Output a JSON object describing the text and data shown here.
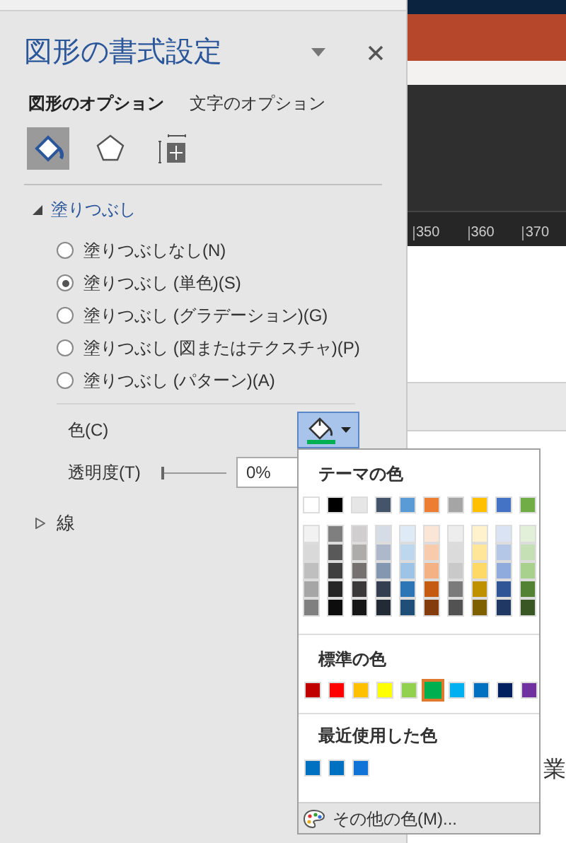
{
  "panel": {
    "title": "図形の書式設定",
    "tabs": [
      {
        "label": "図形のオプション",
        "selected": true
      },
      {
        "label": "文字のオプション",
        "selected": false
      }
    ],
    "icon_tabs": [
      {
        "kind": "fill",
        "selected": true
      },
      {
        "kind": "effects",
        "selected": false
      },
      {
        "kind": "size",
        "selected": false
      }
    ],
    "fill_section": {
      "title": "塗りつぶし",
      "expanded": true,
      "options": [
        {
          "label": "塗りつぶしなし(N)",
          "selected": false
        },
        {
          "label": "塗りつぶし (単色)(S)",
          "selected": true
        },
        {
          "label": "塗りつぶし (グラデーション)(G)",
          "selected": false
        },
        {
          "label": "塗りつぶし (図またはテクスチャ)(P)",
          "selected": false
        },
        {
          "label": "塗りつぶし (パターン)(A)",
          "selected": false
        }
      ],
      "color_label": "色(C)",
      "color": "#00b050",
      "transparency_label": "透明度(T)",
      "transparency": {
        "level": 0,
        "value": "0%"
      }
    },
    "line_section": {
      "title": "線",
      "expanded": false
    }
  },
  "document": {
    "ruler_labels": [
      "350",
      "360",
      "370"
    ],
    "text": "業"
  },
  "color_menu": {
    "theme_title": "テーマの色",
    "theme_colors": [
      {
        "color": "#ffffff",
        "selected": false
      },
      {
        "color": "#000000",
        "selected": false
      },
      {
        "color": "#e7e6e6",
        "selected": false
      },
      {
        "color": "#44546a",
        "selected": false
      },
      {
        "color": "#5b9bd5",
        "selected": false
      },
      {
        "color": "#ed7d31",
        "selected": false
      },
      {
        "color": "#a5a5a5",
        "selected": false
      },
      {
        "color": "#ffc000",
        "selected": false
      },
      {
        "color": "#4472c4",
        "selected": false
      },
      {
        "color": "#70ad47",
        "selected": false
      }
    ],
    "shade_columns": [
      {
        "shades": [
          {
            "color": "#f2f2f2",
            "selected": false
          },
          {
            "color": "#d9d9d9",
            "selected": false
          },
          {
            "color": "#bfbfbf",
            "selected": false
          },
          {
            "color": "#a6a6a6",
            "selected": false
          },
          {
            "color": "#808080",
            "selected": false
          }
        ]
      },
      {
        "shades": [
          {
            "color": "#7f7f7f",
            "selected": false
          },
          {
            "color": "#595959",
            "selected": false
          },
          {
            "color": "#404040",
            "selected": false
          },
          {
            "color": "#262626",
            "selected": false
          },
          {
            "color": "#0d0d0d",
            "selected": false
          }
        ]
      },
      {
        "shades": [
          {
            "color": "#d0cece",
            "selected": false
          },
          {
            "color": "#aeabab",
            "selected": false
          },
          {
            "color": "#757171",
            "selected": false
          },
          {
            "color": "#3a3838",
            "selected": false
          },
          {
            "color": "#171616",
            "selected": false
          }
        ]
      },
      {
        "shades": [
          {
            "color": "#d6dce5",
            "selected": false
          },
          {
            "color": "#adb9ca",
            "selected": false
          },
          {
            "color": "#8497b0",
            "selected": false
          },
          {
            "color": "#333f50",
            "selected": false
          },
          {
            "color": "#222a35",
            "selected": false
          }
        ]
      },
      {
        "shades": [
          {
            "color": "#deebf7",
            "selected": false
          },
          {
            "color": "#bdd7ee",
            "selected": false
          },
          {
            "color": "#9dc3e6",
            "selected": false
          },
          {
            "color": "#2e75b6",
            "selected": false
          },
          {
            "color": "#1f4e79",
            "selected": false
          }
        ]
      },
      {
        "shades": [
          {
            "color": "#fbe5d6",
            "selected": false
          },
          {
            "color": "#f8cbad",
            "selected": false
          },
          {
            "color": "#f4b183",
            "selected": false
          },
          {
            "color": "#c55a11",
            "selected": false
          },
          {
            "color": "#843c0c",
            "selected": false
          }
        ]
      },
      {
        "shades": [
          {
            "color": "#ededed",
            "selected": false
          },
          {
            "color": "#dbdbdb",
            "selected": false
          },
          {
            "color": "#c9c9c9",
            "selected": false
          },
          {
            "color": "#7b7b7b",
            "selected": false
          },
          {
            "color": "#525252",
            "selected": false
          }
        ]
      },
      {
        "shades": [
          {
            "color": "#fff2cc",
            "selected": false
          },
          {
            "color": "#ffe699",
            "selected": false
          },
          {
            "color": "#ffd966",
            "selected": false
          },
          {
            "color": "#bf9000",
            "selected": false
          },
          {
            "color": "#7f6000",
            "selected": false
          }
        ]
      },
      {
        "shades": [
          {
            "color": "#dae3f3",
            "selected": false
          },
          {
            "color": "#b4c7e7",
            "selected": false
          },
          {
            "color": "#8faadc",
            "selected": false
          },
          {
            "color": "#2f5597",
            "selected": false
          },
          {
            "color": "#203864",
            "selected": false
          }
        ]
      },
      {
        "shades": [
          {
            "color": "#e2f0d9",
            "selected": false
          },
          {
            "color": "#c5e0b4",
            "selected": false
          },
          {
            "color": "#a9d18e",
            "selected": false
          },
          {
            "color": "#548235",
            "selected": false
          },
          {
            "color": "#385723",
            "selected": false
          }
        ]
      }
    ],
    "standard_title": "標準の色",
    "standard_colors": [
      {
        "color": "#c00000",
        "selected": false
      },
      {
        "color": "#ff0000",
        "selected": false
      },
      {
        "color": "#ffc000",
        "selected": false
      },
      {
        "color": "#ffff00",
        "selected": false
      },
      {
        "color": "#92d050",
        "selected": false
      },
      {
        "color": "#00b050",
        "selected": true
      },
      {
        "color": "#00b0f0",
        "selected": false
      },
      {
        "color": "#0070c0",
        "selected": false
      },
      {
        "color": "#002060",
        "selected": false
      },
      {
        "color": "#7030a0",
        "selected": false
      }
    ],
    "recent_title": "最近使用した色",
    "recent_colors": [
      {
        "color": "#0070c0",
        "selected": false
      },
      {
        "color": "#0070c0",
        "selected": false
      },
      {
        "color": "#0f73d8",
        "selected": false
      }
    ],
    "more_colors": "その他の色(M)..."
  }
}
